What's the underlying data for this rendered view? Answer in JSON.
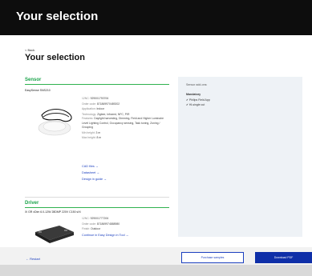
{
  "header": {
    "title": "Your selection"
  },
  "breadcrumb": {
    "back_label": "< Back"
  },
  "page_title": "Your selection",
  "sensor": {
    "section_label": "Sensor",
    "product_name": "EasySense SNS210",
    "specs": [
      {
        "key": "12NC:",
        "value": "929001793706"
      },
      {
        "key": "Order code:",
        "value": "871869970489202"
      },
      {
        "key": "Application:",
        "value": "Indoor"
      },
      {
        "key": "Technology:",
        "value": "Zigbee, Infrared, NFC, PIR"
      },
      {
        "key": "Features:",
        "value": "Daylight harvesting, Dimming, Field and Higher Luminaire Level Lighting Control, Occupancy sensing, Task tuning, Zoning / Grouping"
      },
      {
        "key": "Min height:",
        "value": "3 m"
      },
      {
        "key": "Max height:",
        "value": "8 m"
      }
    ],
    "links": [
      "CAD files →",
      "Datasheet →",
      "Design in guide →"
    ]
  },
  "driver": {
    "section_label": "Driver",
    "product_name": "Xi GR xDim 6.0-12W 28DMP 220V C150 sXt",
    "specs": [
      {
        "key": "12NC:",
        "value": "929001777206"
      },
      {
        "key": "Order code:",
        "value": "871869974888980"
      },
      {
        "key": "Finish:",
        "value": "Outdoor"
      }
    ],
    "links": [
      "Continue in Easy Design in Tool →"
    ]
  },
  "panel": {
    "title": "Sensor add-ons:",
    "mandatory_label": "Mandatory",
    "items": [
      "✔ Philips Field App",
      "✔ Hl-single cut"
    ]
  },
  "footer": {
    "restart_label": "← Restart",
    "purchase_label": "Purchase samples",
    "download_label": "Download PDF"
  }
}
